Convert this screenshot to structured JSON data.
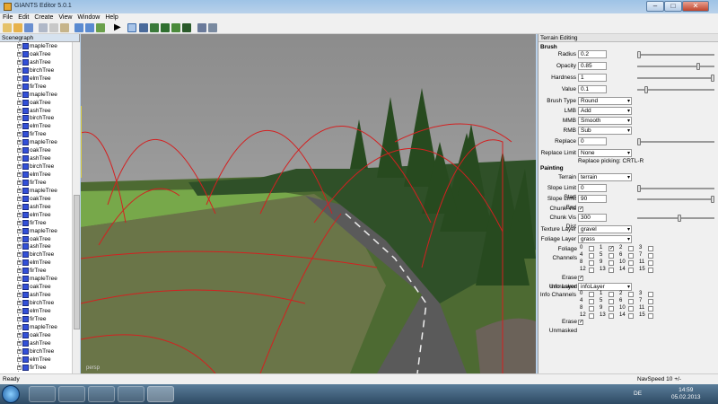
{
  "window": {
    "title": "GIANTS Editor 5.0.1",
    "minimize": "–",
    "maximize": "□",
    "close": "✕"
  },
  "menu": [
    "File",
    "Edit",
    "Create",
    "View",
    "Window",
    "Help"
  ],
  "scenegraph": {
    "title": "Scenegraph",
    "items": [
      "mapleTree",
      "oakTree",
      "ashTree",
      "birchTree",
      "elmTree",
      "firTree",
      "mapleTree",
      "oakTree",
      "ashTree",
      "birchTree",
      "elmTree",
      "firTree",
      "mapleTree",
      "oakTree",
      "ashTree",
      "birchTree",
      "elmTree",
      "firTree",
      "mapleTree",
      "oakTree",
      "ashTree",
      "elmTree",
      "firTree",
      "mapleTree",
      "oakTree",
      "ashTree",
      "birchTree",
      "elmTree",
      "firTree",
      "mapleTree",
      "oakTree",
      "ashTree",
      "birchTree",
      "elmTree",
      "firTree",
      "mapleTree",
      "oakTree",
      "ashTree",
      "birchTree",
      "elmTree",
      "firTree"
    ]
  },
  "viewport": {
    "label": "persp"
  },
  "terrain": {
    "title": "Terrain Editing",
    "brush_header": "Brush",
    "radius_label": "Radius",
    "radius": "0.2",
    "opacity_label": "Opacity",
    "opacity": "0.85",
    "hardness_label": "Hardness",
    "hardness": "1",
    "value_label": "Value",
    "value": "0.1",
    "brush_type_label": "Brush Type",
    "brush_type": "Round",
    "lmb_label": "LMB",
    "lmb": "Add",
    "mmb_label": "MMB",
    "mmb": "Smooth",
    "rmb_label": "RMB",
    "rmb": "Sub",
    "replace_label": "Replace",
    "replace": "0",
    "replace_limit_label": "Replace Limit",
    "replace_limit": "None",
    "replace_picking": "Replace picking: CRTL-R",
    "painting_header": "Painting",
    "terrain_label": "Terrain",
    "terrain": "terrain",
    "slope_start_label": "Slope Limit Start",
    "slope_start": "0",
    "slope_end_label": "Slope Limit End",
    "slope_end": "90",
    "chunk_vis_label": "Chunk Vis",
    "chunk_vis_dist_label": "Chunk Vis Dist",
    "chunk_vis_dist": "300",
    "texture_layer_label": "Texture Layer",
    "texture_layer": "gravel",
    "foliage_layer_label": "Foliage Layer",
    "foliage_layer": "grass",
    "foliage_channels_label": "Foliage Channels",
    "erase_unmasked_label": "Erase Unmasked",
    "info_layer_label": "Info Layer",
    "info_layer": "infoLayer",
    "info_channels_label": "Info Channels",
    "erase_unmasked2_label": "Erase Unmasked",
    "channels": [
      "0",
      "1",
      "2",
      "3",
      "4",
      "5",
      "6",
      "7",
      "8",
      "9",
      "10",
      "11",
      "12",
      "13",
      "14",
      "15"
    ],
    "slider_levels": {
      "radius": 0.0,
      "opacity": 0.8,
      "hardness": 1.0,
      "value": 0.1,
      "replace": 0.0,
      "slope_start": 0.0,
      "slope_end": 1.0,
      "chunk_vis_dist": 0.55
    }
  },
  "status": {
    "left": "Ready",
    "right": "NavSpeed 10 +/-"
  },
  "taskbar": {
    "lang": "DE",
    "time": "14:59",
    "date": "05.02.2013"
  }
}
